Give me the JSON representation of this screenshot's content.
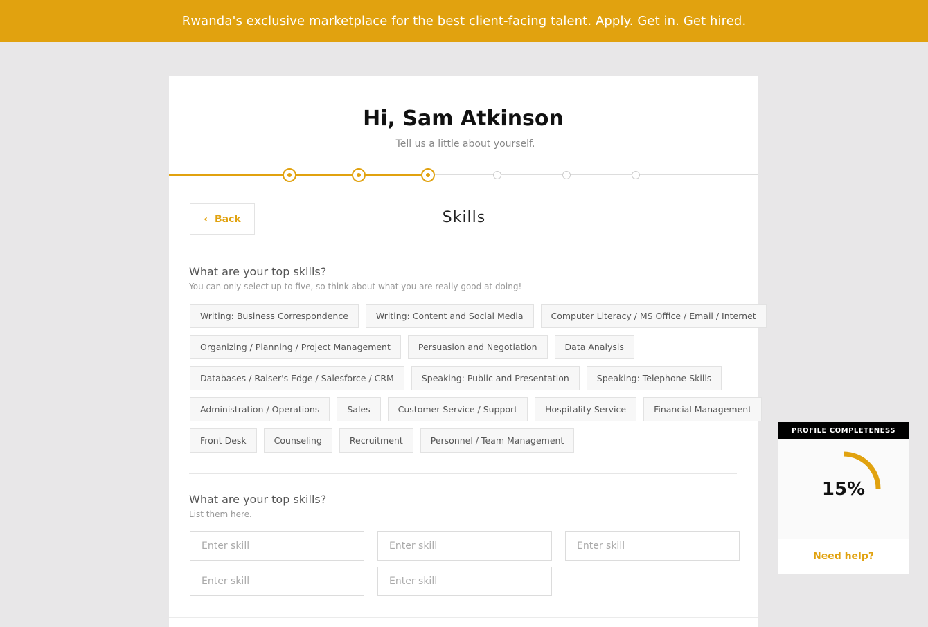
{
  "banner": {
    "text": "Rwanda's exclusive marketplace for the best client-facing talent. Apply. Get in. Get hired."
  },
  "header": {
    "greeting": "Hi, Sam Atkinson",
    "subtitle": "Tell us a little about yourself."
  },
  "progress": {
    "total_steps": 6,
    "completed_steps": 3
  },
  "section": {
    "back_label": "Back",
    "title": "Skills"
  },
  "top_skills": {
    "title": "What are your top skills?",
    "subtitle": "You can only select up to five, so think about what you are really good at doing!",
    "rows": [
      [
        "Writing: Business Correspondence",
        "Writing: Content and Social Media",
        "Computer Literacy / MS Office / Email / Internet"
      ],
      [
        "Organizing / Planning / Project Management",
        "Persuasion and Negotiation",
        "Data Analysis"
      ],
      [
        "Databases / Raiser's Edge / Salesforce / CRM",
        "Speaking: Public and Presentation",
        "Speaking: Telephone Skills"
      ],
      [
        "Administration / Operations",
        "Sales",
        "Customer Service / Support",
        "Hospitality Service",
        "Financial Management"
      ],
      [
        "Front Desk",
        "Counseling",
        "Recruitment",
        "Personnel / Team Management"
      ]
    ]
  },
  "custom_skills": {
    "title": "What are your top skills?",
    "subtitle": "List them here.",
    "inputs": [
      {
        "placeholder": "Enter skill",
        "value": ""
      },
      {
        "placeholder": "Enter skill",
        "value": ""
      },
      {
        "placeholder": "Enter skill",
        "value": ""
      },
      {
        "placeholder": "Enter skill",
        "value": ""
      },
      {
        "placeholder": "Enter skill",
        "value": ""
      }
    ]
  },
  "completeness": {
    "header": "PROFILE COMPLETENESS",
    "percent": 15,
    "percent_label": "15%",
    "help_label": "Need help?"
  },
  "colors": {
    "accent": "#e1a20f",
    "background": "#e8e7e8",
    "widget_header": "#000000"
  },
  "icons": {
    "back": "chevron-left-icon"
  }
}
